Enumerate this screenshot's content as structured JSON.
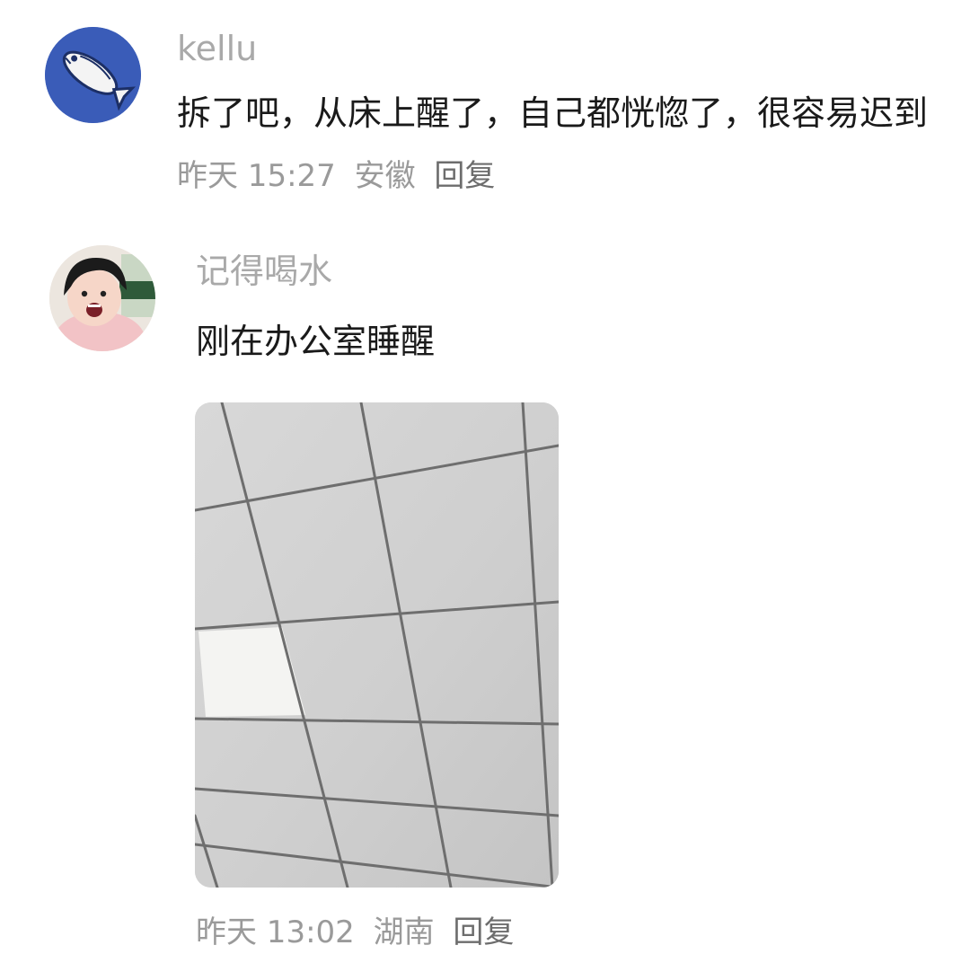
{
  "comments": [
    {
      "username": "kellu",
      "avatar_icon": "fish-icon",
      "avatar_color": "#3a5cb8",
      "text_main": "拆了吧，从床上醒了，自己都恍惚了，很容易迟到",
      "time": "昨天 15:27",
      "location": "安徽",
      "reply_label": "回复"
    },
    {
      "username": "记得喝水",
      "avatar_icon": "person-photo-avatar",
      "text_main": "刚在办公室睡醒",
      "image_icon": "office-ceiling-photo",
      "time": "昨天 13:02",
      "location": "湖南",
      "reply_label": "回复"
    }
  ]
}
